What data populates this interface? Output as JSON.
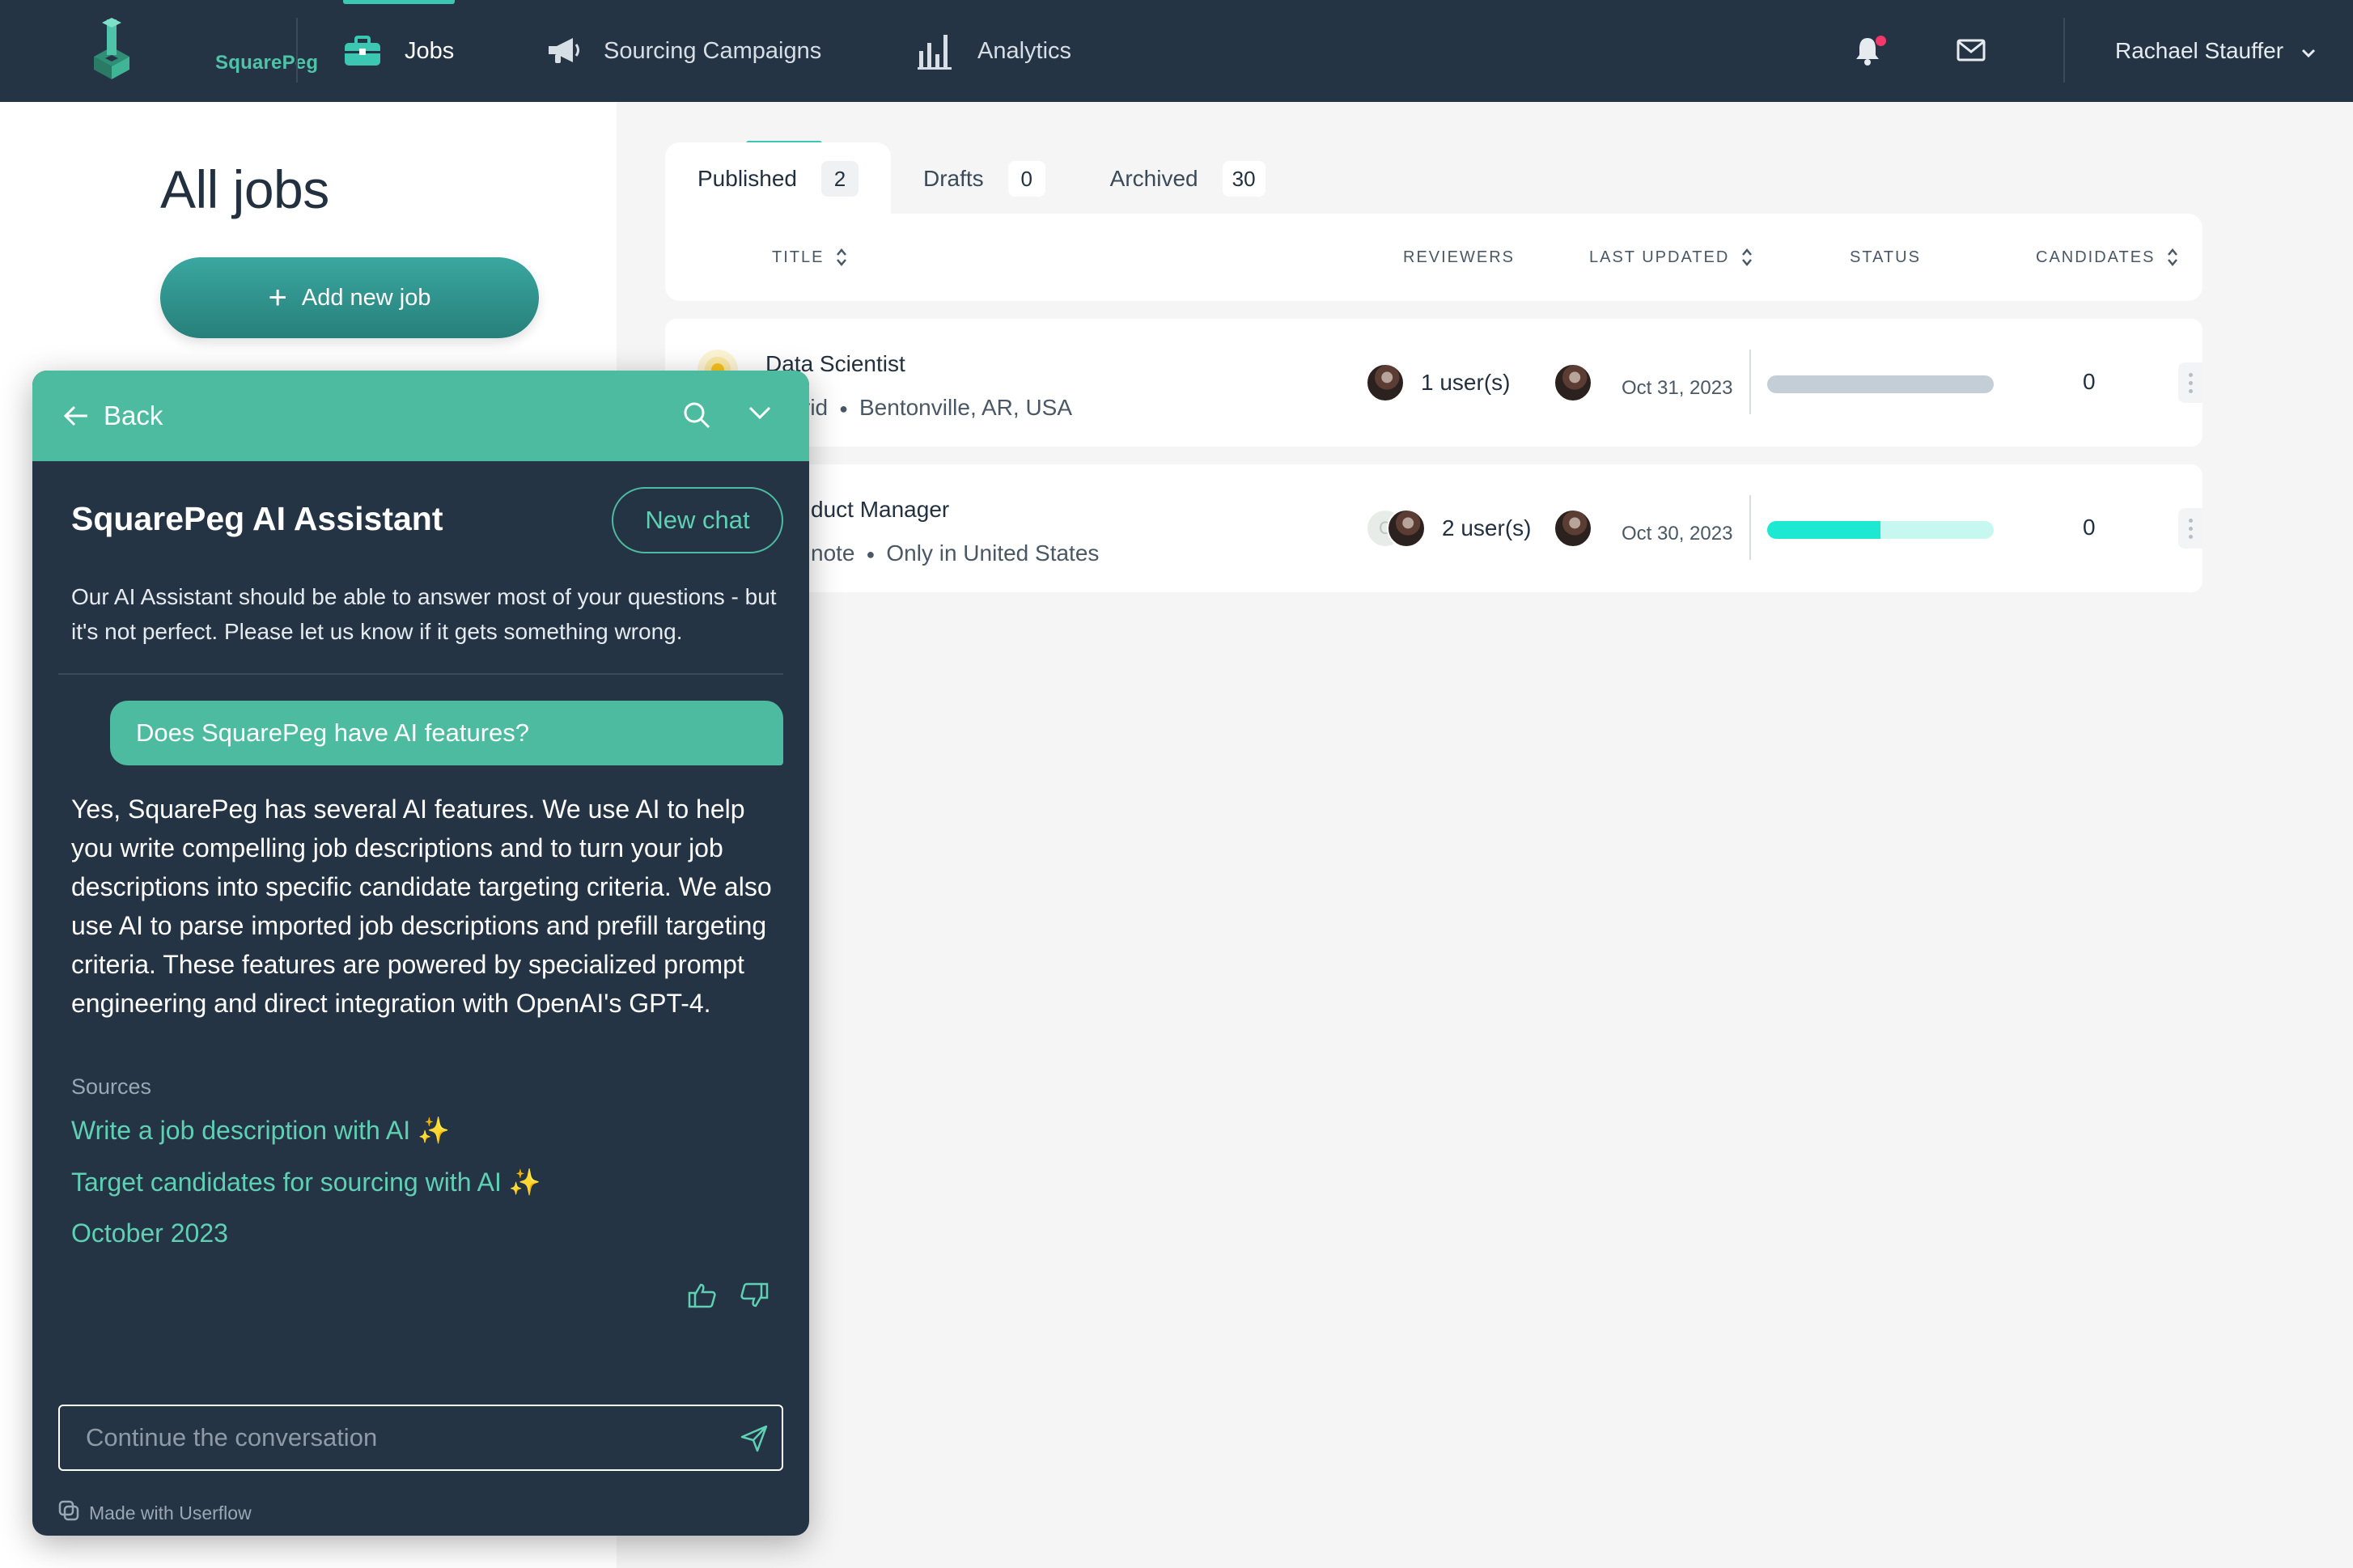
{
  "nav": {
    "logo_text": "SquarePeg",
    "jobs": "Jobs",
    "sourcing": "Sourcing Campaigns",
    "analytics": "Analytics",
    "user_name": "Rachael Stauffer"
  },
  "page": {
    "title": "All jobs",
    "add_job": "Add new job"
  },
  "tabs": [
    {
      "label": "Published",
      "count": "2"
    },
    {
      "label": "Drafts",
      "count": "0"
    },
    {
      "label": "Archived",
      "count": "30"
    }
  ],
  "table": {
    "headers": {
      "title": "TITLE",
      "reviewers": "REVIEWERS",
      "last_updated": "LAST UPDATED",
      "status": "STATUS",
      "candidates": "CANDIDATES"
    },
    "rows": [
      {
        "title": "Data Scientist",
        "work_type": "rid",
        "location": "Bentonville, AR, USA",
        "reviewers": "1 user(s)",
        "last_updated": "Oct 31, 2023",
        "status_progress": 0,
        "candidates": "0"
      },
      {
        "title": "duct Manager",
        "work_type": "note",
        "location": "Only in United States",
        "reviewers": "2 user(s)",
        "last_updated": "Oct 30, 2023",
        "status_progress": 0.5,
        "candidates": "0"
      }
    ]
  },
  "assistant": {
    "back": "Back",
    "title": "SquarePeg AI Assistant",
    "new_chat": "New chat",
    "description": "Our AI Assistant should be able to answer most of your questions - but it's not perfect. Please let us know if it gets something wrong.",
    "user_message": "Does SquarePeg have AI features?",
    "answer": "Yes, SquarePeg has several AI features. We use AI to help you write compelling job descriptions and to turn your job descriptions into specific candidate targeting criteria. We also use AI to parse imported job descriptions and prefill targeting criteria. These features are powered by specialized prompt engineering and direct integration with OpenAI's GPT-4.",
    "sources_label": "Sources",
    "sources": [
      "Write a job description with AI ✨",
      "Target candidates for sourcing with AI ✨",
      "October 2023"
    ],
    "input_placeholder": "Continue the conversation",
    "made_with": "Made with Userflow"
  },
  "colors": {
    "nav_bg": "#243444",
    "accent": "#3cc7b3",
    "assistant_header": "#4dbb9f",
    "progress_fill": "#1de9d2"
  }
}
